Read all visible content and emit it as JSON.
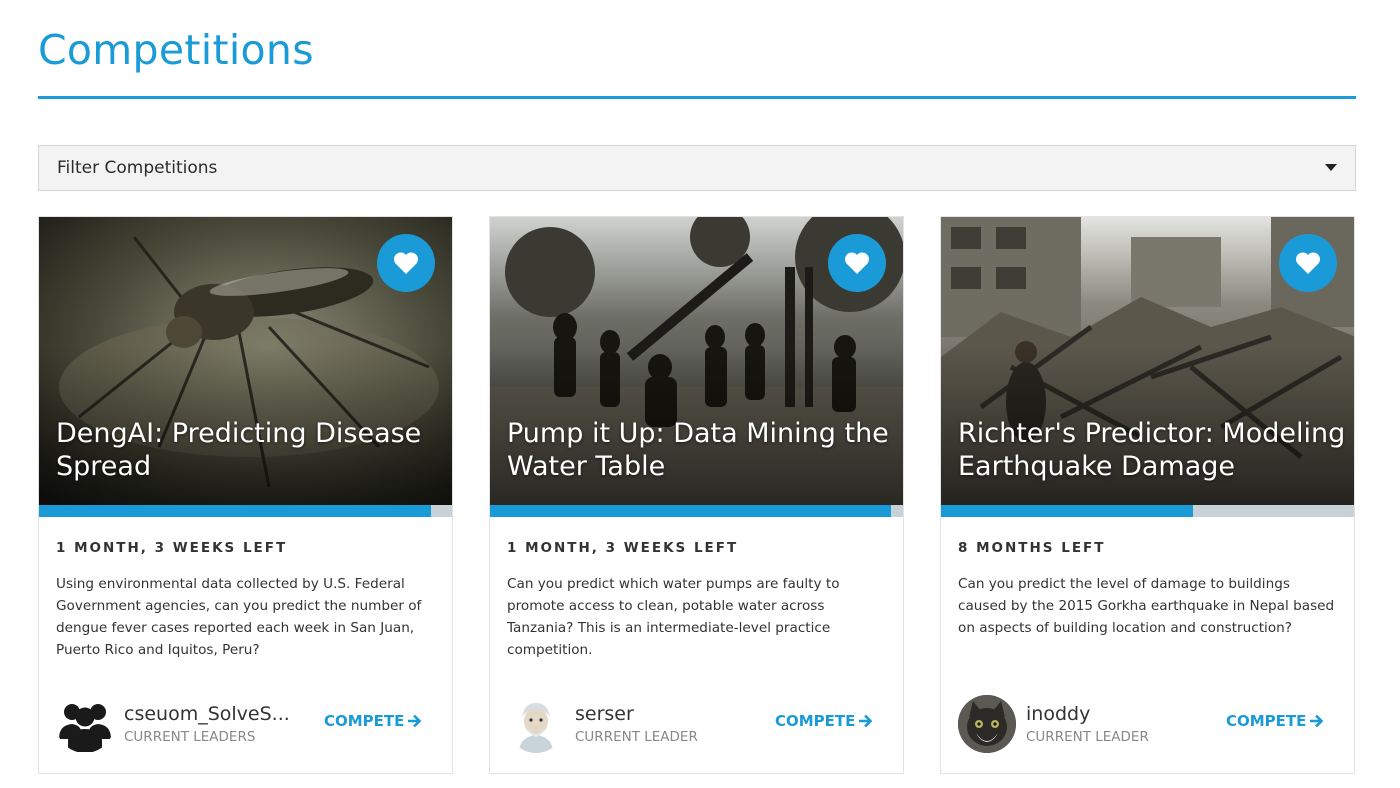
{
  "page": {
    "title": "Competitions"
  },
  "filter": {
    "label": "Filter Competitions"
  },
  "colors": {
    "accent": "#1a9bd7",
    "progress_track": "#c8d0d8"
  },
  "cards": [
    {
      "title": "DengAI: Predicting Disease Spread",
      "time_left": "1 MONTH, 3 WEEKS LEFT",
      "progress": 0.95,
      "description": "Using environmental data collected by U.S. Federal Government agencies, can you predict the number of dengue fever cases reported each week in San Juan, Puerto Rico and Iquitos, Peru?",
      "leader_name": "cseuom_SolveS...",
      "leader_caption": "CURRENT LEADERS",
      "avatar_icon": "group-icon",
      "compete_label": "COMPETE",
      "favorite_icon": "heart-icon"
    },
    {
      "title": "Pump it Up: Data Mining the Water Table",
      "time_left": "1 MONTH, 3 WEEKS LEFT",
      "progress": 0.97,
      "description": "Can you predict which water pumps are faulty to promote access to clean, potable water across Tanzania? This is an intermediate-level practice competition.",
      "leader_name": "serser",
      "leader_caption": "CURRENT LEADER",
      "avatar_icon": "user-avatar",
      "compete_label": "COMPETE",
      "favorite_icon": "heart-icon"
    },
    {
      "title": "Richter's Predictor: Modeling Earthquake Damage",
      "time_left": "8 MONTHS LEFT",
      "progress": 0.61,
      "description": "Can you predict the level of damage to buildings caused by the 2015 Gorkha earthquake in Nepal based on aspects of building location and construction?",
      "leader_name": "inoddy",
      "leader_caption": "CURRENT LEADER",
      "avatar_icon": "user-avatar",
      "compete_label": "COMPETE",
      "favorite_icon": "heart-icon"
    }
  ]
}
